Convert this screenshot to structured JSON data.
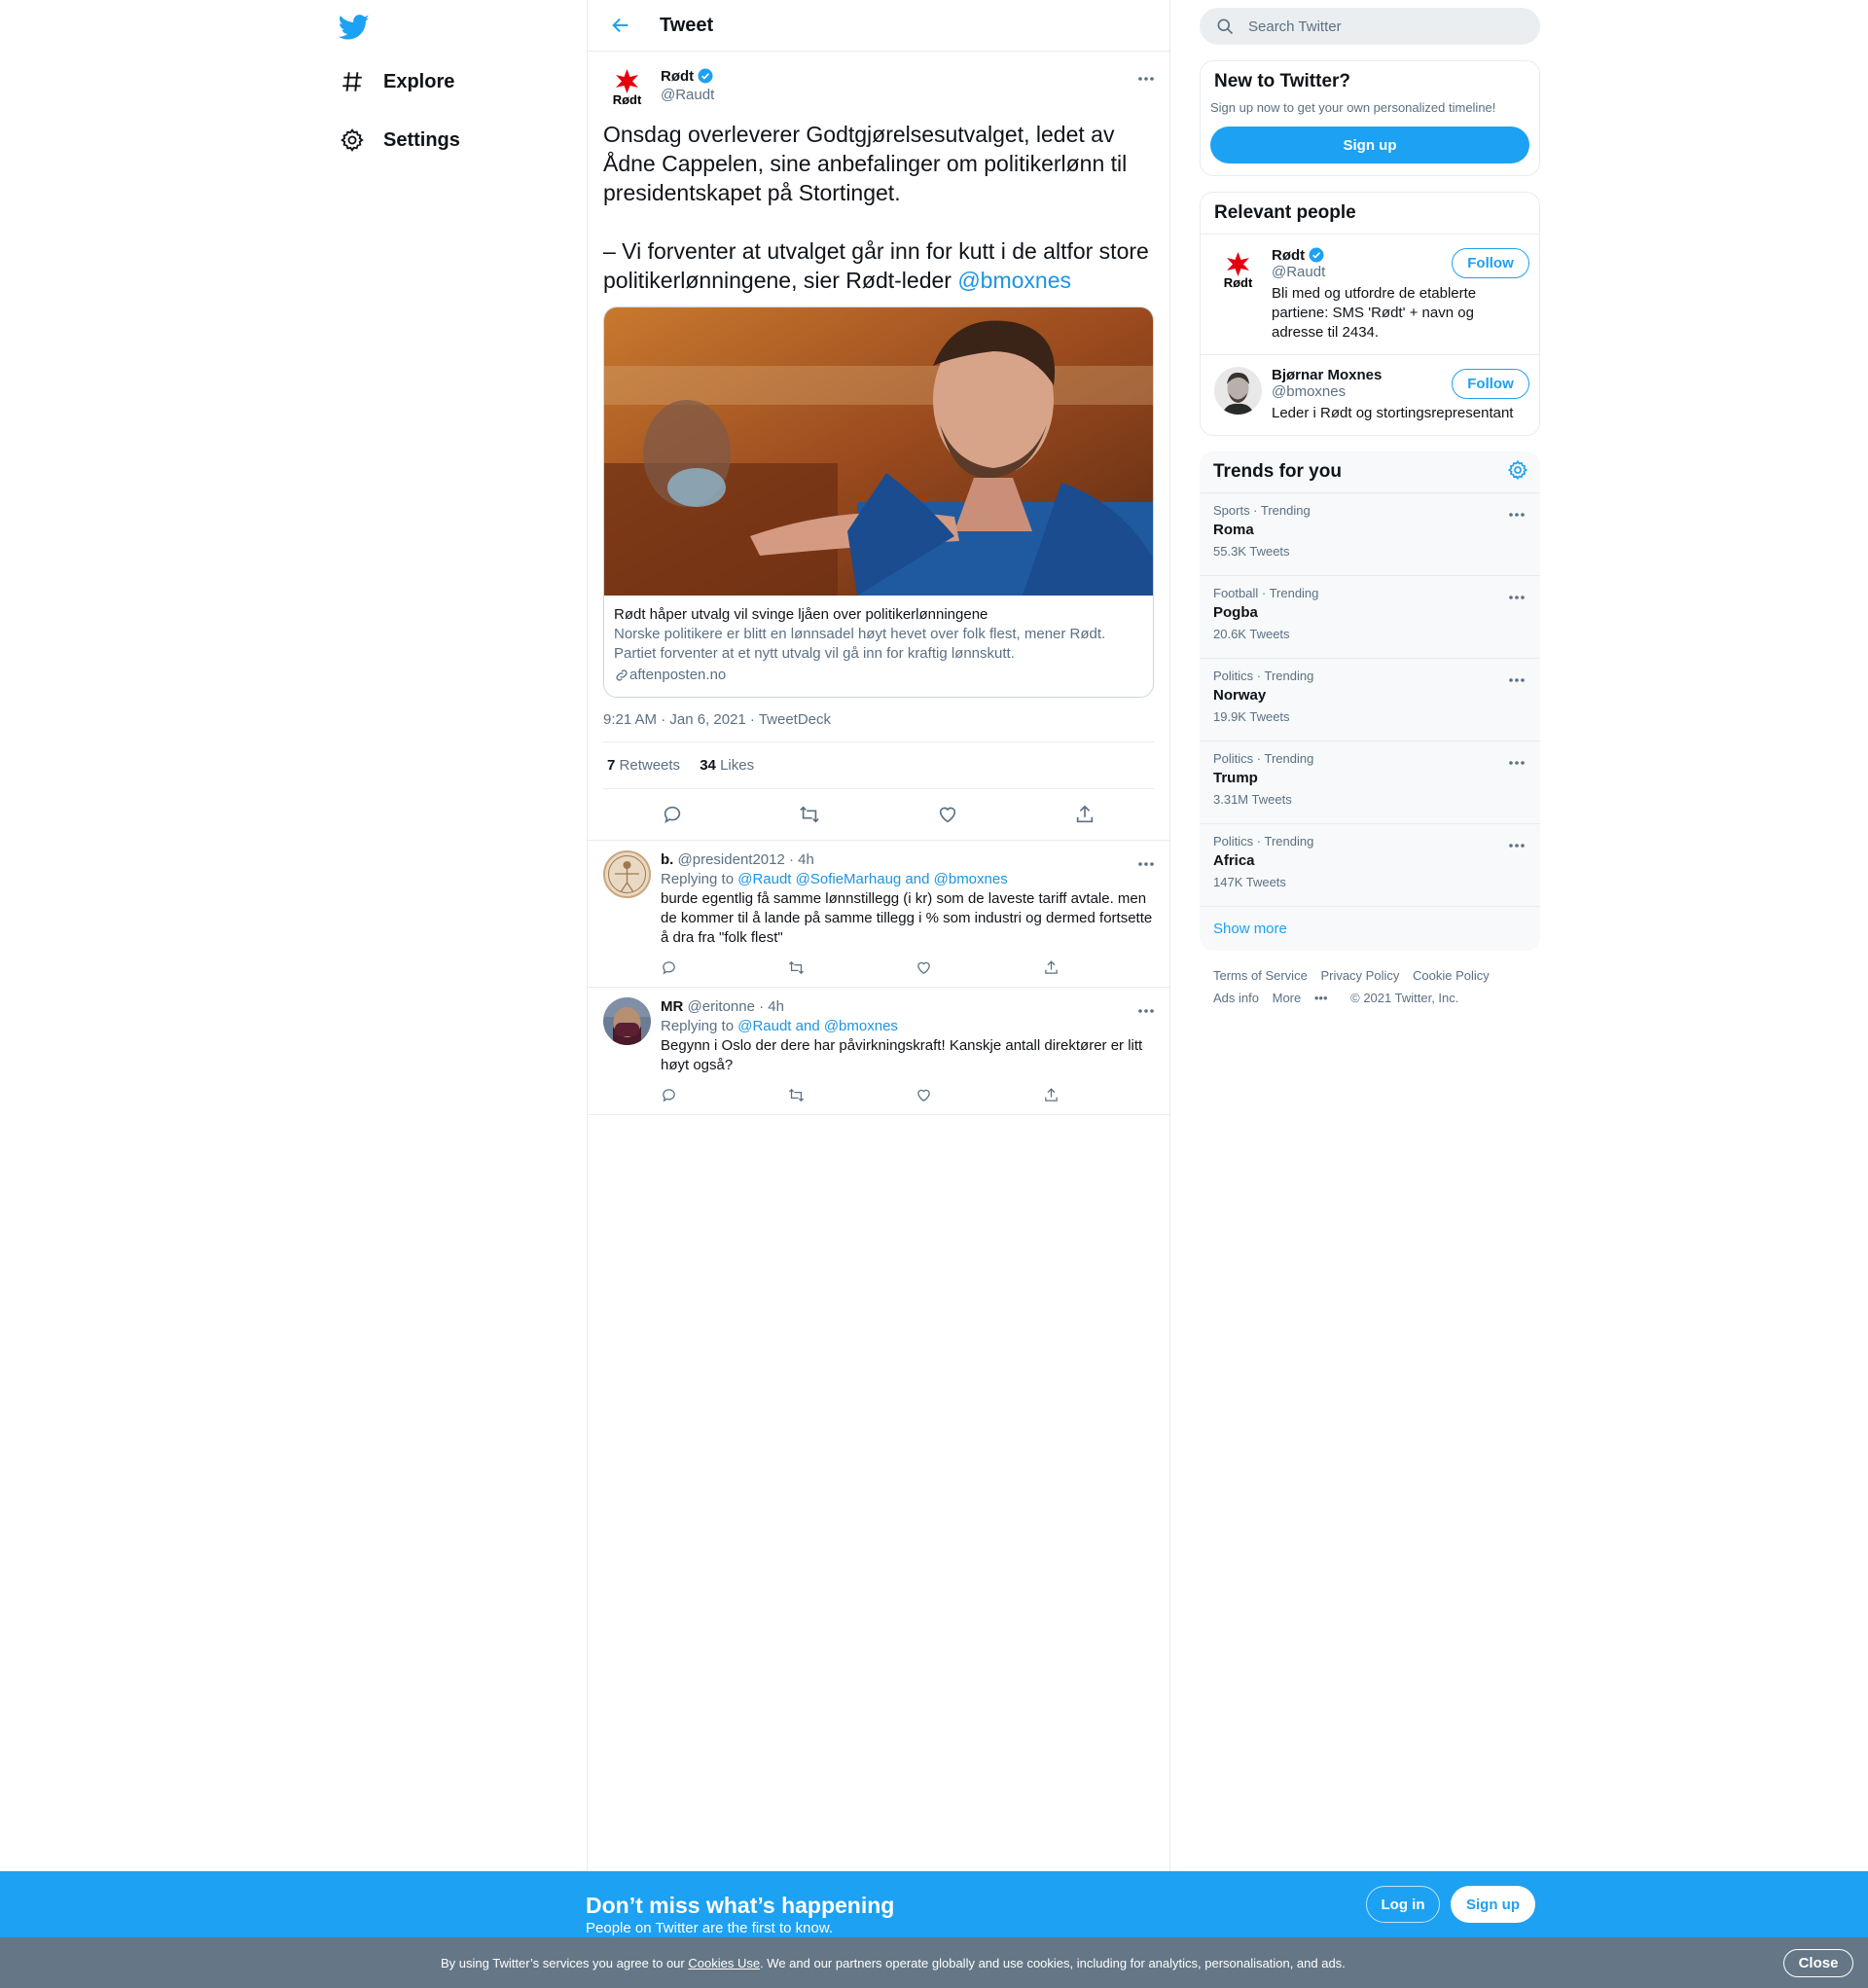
{
  "nav": {
    "logo": "twitter-bird-icon",
    "items": [
      {
        "label": "Explore",
        "icon": "hashtag-icon"
      },
      {
        "label": "Settings",
        "icon": "gear-icon"
      }
    ]
  },
  "header": {
    "title": "Tweet"
  },
  "tweet": {
    "author_name": "Rødt",
    "author_handle": "@Raudt",
    "text_main": "Onsdag overleverer Godtgjørelsesutvalget, ledet av Ådne Cappelen, sine anbefalinger om politikerlønn til presidentskapet på Stortinget.\n\n– Vi forventer at utvalget går inn for kutt i de altfor store politikerlønningene, sier Rødt-leder ",
    "text_mention": "@bmoxnes",
    "card": {
      "title": "Rødt håper utvalg vil svinge ljåen over politikerlønningene",
      "description": "Norske politikere er blitt en lønnsadel høyt hevet over folk flest, mener Rødt. Partiet forventer at et nytt utvalg vil gå inn for kraftig lønnskutt.",
      "domain": "aftenposten.no"
    },
    "timestamp": "9:21 AM · Jan 6, 2021 · TweetDeck",
    "retweets_count": "7",
    "retweets_label": "Retweets",
    "likes_count": "34",
    "likes_label": "Likes"
  },
  "replies": [
    {
      "name": "b.",
      "meta": "@president2012 · 4h",
      "replying_prefix": "Replying to ",
      "replying_to": "@Raudt @SofieMarhaug and @bmoxnes",
      "text": "burde egentlig få samme lønnstillegg (i kr) som de laveste tariff avtale. men de kommer til å lande på samme tillegg i % som industri og dermed fortsette å dra fra \"folk flest\""
    },
    {
      "name": "MR",
      "meta": "@eritonne · 4h",
      "replying_prefix": "Replying to ",
      "replying_to": "@Raudt and @bmoxnes",
      "text": "Begynn i Oslo der dere har påvirkningskraft! Kanskje antall direktører er litt høyt også?"
    }
  ],
  "sidebar": {
    "search_placeholder": "Search Twitter",
    "new_to_twitter": {
      "title": "New to Twitter?",
      "subtitle": "Sign up now to get your own personalized timeline!",
      "button": "Sign up"
    },
    "relevant_people": {
      "title": "Relevant people",
      "people": [
        {
          "name": "Rødt",
          "handle": "@Raudt",
          "bio": "Bli med og utfordre de etablerte partiene: SMS 'Rødt' + navn og adresse til 2434.",
          "button": "Follow"
        },
        {
          "name": "Bjørnar Moxnes",
          "handle": "@bmoxnes",
          "bio": "Leder i Rødt og stortingsrepresentant",
          "button": "Follow"
        }
      ]
    },
    "trends": {
      "title": "Trends for you",
      "items": [
        {
          "category": "Sports · Trending",
          "name": "Roma",
          "count": "55.3K Tweets"
        },
        {
          "category": "Football · Trending",
          "name": "Pogba",
          "count": "20.6K Tweets"
        },
        {
          "category": "Politics · Trending",
          "name": "Norway",
          "count": "19.9K Tweets"
        },
        {
          "category": "Politics · Trending",
          "name": "Trump",
          "count": "3.31M Tweets"
        },
        {
          "category": "Politics · Trending",
          "name": "Africa",
          "count": "147K Tweets"
        }
      ],
      "show_more": "Show more"
    },
    "footer": {
      "links": [
        "Terms of Service",
        "Privacy Policy",
        "Cookie Policy",
        "Ads info",
        "More"
      ],
      "copyright": "© 2021 Twitter, Inc."
    }
  },
  "bottom_bar": {
    "title": "Don’t miss what’s happening",
    "subtitle": "People on Twitter are the first to know.",
    "login": "Log in",
    "signup": "Sign up"
  },
  "cookie_bar": {
    "text_before": "By using Twitter’s services you agree to our ",
    "link": "Cookies Use",
    "text_after": ". We and our partners operate globally and use cookies, including for analytics, personalisation, and ads.",
    "close": "Close"
  },
  "colors": {
    "accent": "#1da1f2",
    "link": "#1b95e0",
    "muted": "#5b7083",
    "cookie_bg": "#657786"
  }
}
